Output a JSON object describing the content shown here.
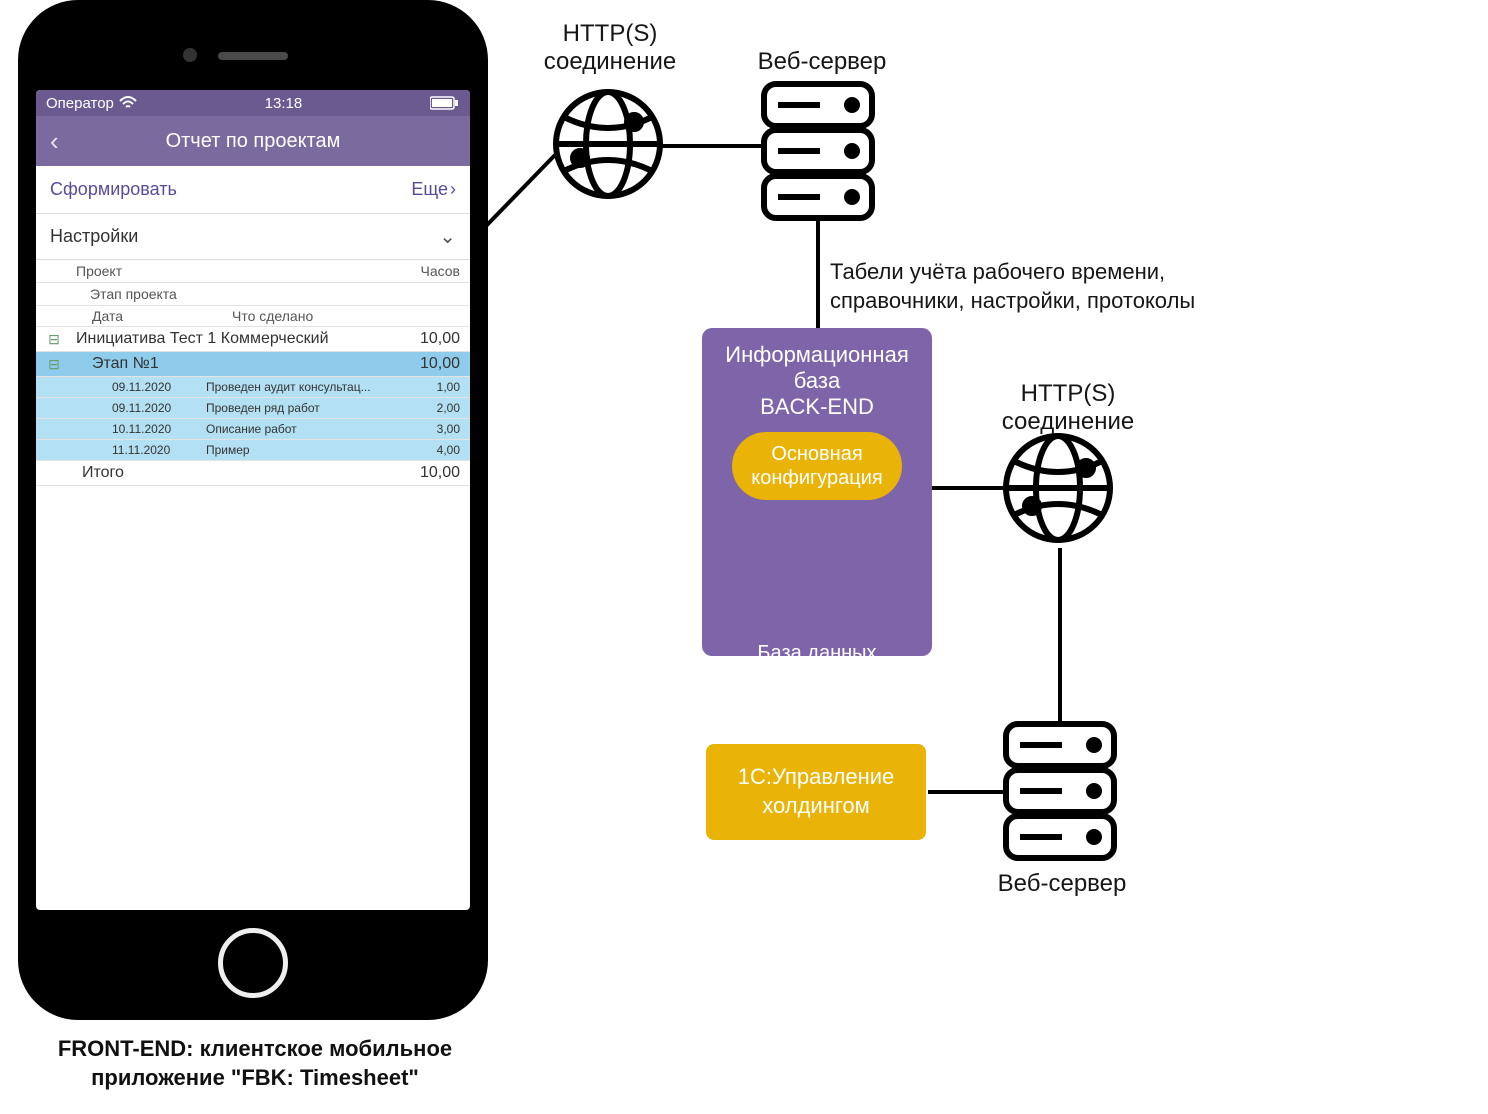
{
  "phone": {
    "status": {
      "carrier": "Оператор",
      "time": "13:18"
    },
    "header": {
      "title": "Отчет по проектам"
    },
    "toolbar": {
      "generate": "Сформировать",
      "more": "Еще"
    },
    "settings_label": "Настройки",
    "columns": {
      "project": "Проект",
      "hours": "Часов",
      "stage": "Этап проекта",
      "date": "Дата",
      "done": "Что сделано"
    },
    "rows": {
      "initiative": {
        "label": "Инициатива Тест 1 Коммерческий",
        "hours": "10,00"
      },
      "stage": {
        "label": "Этап №1",
        "hours": "10,00"
      },
      "leaves": [
        {
          "date": "09.11.2020",
          "work": "Проведен аудит консультац...",
          "hours": "1,00"
        },
        {
          "date": "09.11.2020",
          "work": "Проведен ряд работ",
          "hours": "2,00"
        },
        {
          "date": "10.11.2020",
          "work": "Описание работ",
          "hours": "3,00"
        },
        {
          "date": "11.11.2020",
          "work": "Пример",
          "hours": "4,00"
        }
      ],
      "total": {
        "label": "Итого",
        "hours": "10,00"
      }
    }
  },
  "diagram": {
    "http_top": "HTTP(S)\nсоединение",
    "webserver_top": "Веб-сервер",
    "flow_text": "Табели учёта рабочего времени, справочники, настройки, протоколы",
    "backend": {
      "title": "Информационная база\nBACK-END",
      "pill": "Основная конфигурация",
      "db": "База данных"
    },
    "http_right": "HTTP(S)\nсоединение",
    "uh": "1С:Управление холдингом",
    "webserver_bottom": "Веб-сервер",
    "caption": "FRONT-END: клиентское мобильное приложение \"FBK: Timesheet\""
  }
}
